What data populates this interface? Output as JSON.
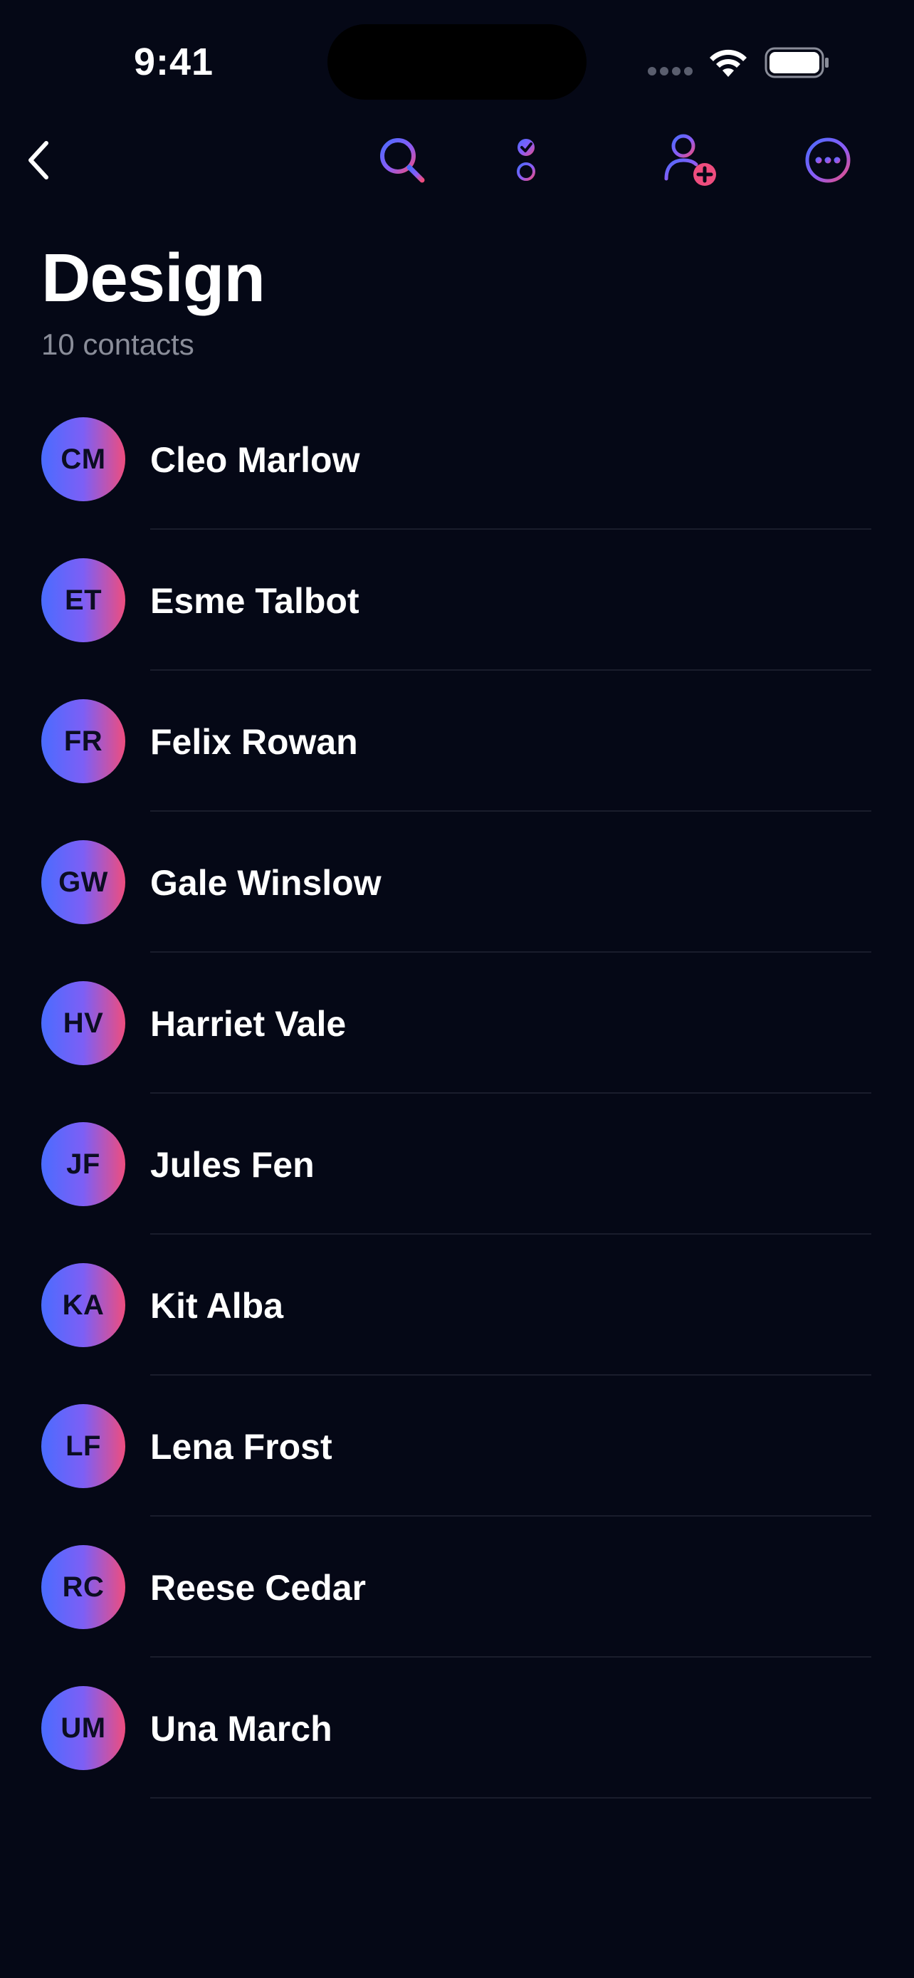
{
  "status_bar": {
    "time": "9:41"
  },
  "nav": {
    "back_icon": "chevron-left-icon",
    "actions": [
      "search-icon",
      "select-list-icon",
      "add-person-icon",
      "more-icon"
    ],
    "accent_gradient": [
      "#4a6cff",
      "#7d5ff5",
      "#ee4d7e"
    ]
  },
  "header": {
    "title": "Design",
    "subtitle": "10 contacts"
  },
  "contacts": [
    {
      "initials": "CM",
      "name": "Cleo Marlow"
    },
    {
      "initials": "ET",
      "name": "Esme Talbot"
    },
    {
      "initials": "FR",
      "name": "Felix Rowan"
    },
    {
      "initials": "GW",
      "name": "Gale Winslow"
    },
    {
      "initials": "HV",
      "name": "Harriet Vale"
    },
    {
      "initials": "JF",
      "name": "Jules Fen"
    },
    {
      "initials": "KA",
      "name": "Kit Alba"
    },
    {
      "initials": "LF",
      "name": "Lena Frost"
    },
    {
      "initials": "RC",
      "name": "Reese Cedar"
    },
    {
      "initials": "UM",
      "name": "Una March"
    }
  ],
  "colors": {
    "background": "#050816",
    "subtitle": "#8a8d99",
    "divider": "#1a1d2c"
  }
}
